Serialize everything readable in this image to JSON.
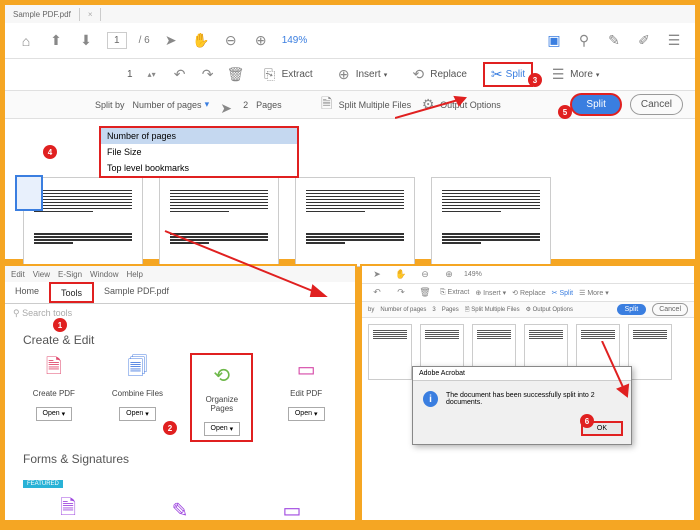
{
  "p1": {
    "tab_name": "Sample PDF.pdf",
    "page_current": "1",
    "page_total": "/ 6",
    "zoom": "149%",
    "page_spinner": "1",
    "extract": "Extract",
    "insert": "Insert",
    "replace": "Replace",
    "split": "Split",
    "more": "More",
    "split_by": "Split by",
    "split_mode": "Number of pages",
    "split_count": "2",
    "split_unit": "Pages",
    "multi": "Split Multiple Files",
    "output": "Output Options",
    "btn_split": "Split",
    "btn_cancel": "Cancel",
    "dd": [
      "Number of pages",
      "File Size",
      "Top level bookmarks"
    ]
  },
  "p2": {
    "menu": [
      "Edit",
      "View",
      "E-Sign",
      "Window",
      "Help"
    ],
    "tabs": [
      "Home",
      "Tools",
      "Sample PDF.pdf"
    ],
    "search": "Search tools",
    "sec1": "Create & Edit",
    "tools": [
      {
        "name": "Create PDF",
        "open": "Open"
      },
      {
        "name": "Combine Files",
        "open": "Open"
      },
      {
        "name": "Organize Pages",
        "open": "Open"
      },
      {
        "name": "Edit PDF",
        "open": "Open"
      }
    ],
    "sec2": "Forms & Signatures",
    "featured": "FEATURED"
  },
  "p3": {
    "zoom": "149%",
    "extract": "Extract",
    "insert": "Insert",
    "replace": "Replace",
    "split": "Split",
    "more": "More",
    "split_by": "by",
    "mode": "Number of pages",
    "count": "3",
    "unit": "Pages",
    "multi": "Split Multiple Files",
    "output": "Output Options",
    "btn_split": "Split",
    "btn_cancel": "Cancel",
    "dlg_title": "Adobe Acrobat",
    "dlg_msg": "The document has been successfully split into 2 documents.",
    "dlg_ok": "OK"
  },
  "badges": {
    "b1": "1",
    "b2": "2",
    "b3": "3",
    "b4": "4",
    "b5": "5",
    "b6": "6"
  }
}
